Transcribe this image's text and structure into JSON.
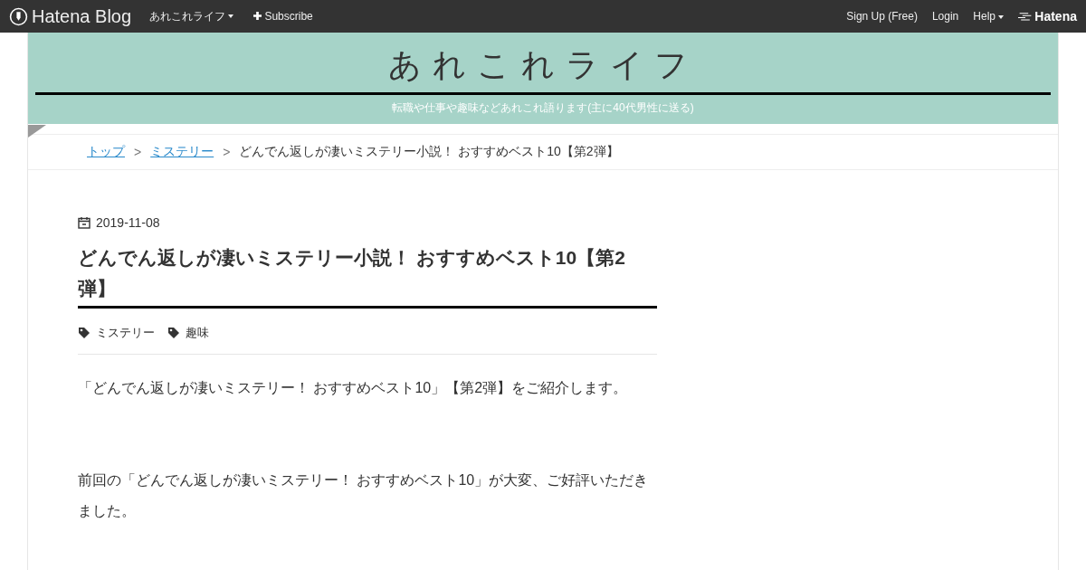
{
  "topbar": {
    "logo": "Hatena Blog",
    "blog_menu": "あれこれライフ",
    "subscribe": "Subscribe",
    "links": [
      "Sign Up (Free)",
      "Login"
    ],
    "help": "Help",
    "brand": "Hatena"
  },
  "header": {
    "title": "あれこれライフ",
    "subtitle": "転職や仕事や趣味などあれこれ語ります(主に40代男性に送る)"
  },
  "breadcrumb": [
    {
      "label": "トップ",
      "kind": "link"
    },
    {
      "label": "ミステリー",
      "kind": "link"
    },
    {
      "label": "どんでん返しが凄いミステリー小説！ おすすめベスト10【第2弾】",
      "kind": "current"
    }
  ],
  "breadcrumb_separator": ">",
  "article": {
    "date": "2019-11-08",
    "title": "どんでん返しが凄いミステリー小説！ おすすめベスト10【第2弾】",
    "categories": [
      "ミステリー",
      "趣味"
    ],
    "paragraphs": [
      "「どんでん返しが凄いミステリー！ おすすめベスト10」【第2弾】をご紹介します。",
      "前回の「どんでん返しが凄いミステリー！ おすすめベスト10」が大変、ご好評いただきました。"
    ]
  }
}
